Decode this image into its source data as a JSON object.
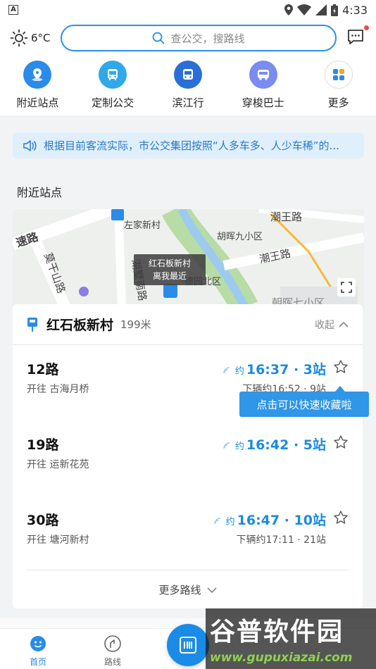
{
  "status": {
    "time": "4:33"
  },
  "header": {
    "temperature": "6°C",
    "search_placeholder": "查公交，搜路线"
  },
  "quicknav": [
    {
      "label": "附近站点",
      "icon": "location-pin-icon",
      "color": "#2a8be8"
    },
    {
      "label": "定制公交",
      "icon": "bus-icon",
      "color": "#2fa9e8"
    },
    {
      "label": "滨江行",
      "icon": "bus-front-icon",
      "color": "#2a6fd8"
    },
    {
      "label": "穿梭巴士",
      "icon": "shuttle-bus-icon",
      "color": "#7b8cf0"
    },
    {
      "label": "更多",
      "icon": "grid-more-icon",
      "color": "#ffffff"
    }
  ],
  "notice": {
    "text": "根据目前客流实际，市公交集团按照“人多车多、人少车稀”的..."
  },
  "nearby": {
    "title": "附近站点"
  },
  "map": {
    "labels": [
      "速路",
      "左家新村",
      "胡晖九小区",
      "潮王路",
      "潮王路",
      "莫干山路",
      "湖墅南路",
      "朝晖七小区",
      "德园北区"
    ],
    "tip_line1": "红石板新村",
    "tip_line2": "离我最近"
  },
  "station": {
    "name": "红石板新村",
    "distance": "199米",
    "collapse_label": "收起",
    "routes": [
      {
        "name": "12路",
        "direction": "开往 古海月桥",
        "approx": "约",
        "eta": "16:37 · 3站",
        "next": "下辆约16:52 · 9站"
      },
      {
        "name": "19路",
        "direction": "开往 运新花苑",
        "approx": "约",
        "eta": "16:42 · 5站",
        "next": ""
      },
      {
        "name": "30路",
        "direction": "开往 塘河新村",
        "approx": "约",
        "eta": "16:47 · 10站",
        "next": "下辆约17:11 · 21站"
      }
    ],
    "more_label": "更多路线"
  },
  "tooltip": {
    "text": "点击可以快速收藏啦"
  },
  "bottomnav": {
    "home": "首页",
    "routes": "路线"
  },
  "watermark": {
    "title": "谷普软件园",
    "url": "www.gupuxiazai.com"
  },
  "colors": {
    "primary": "#2a8be8",
    "eta": "#1a8be0"
  }
}
